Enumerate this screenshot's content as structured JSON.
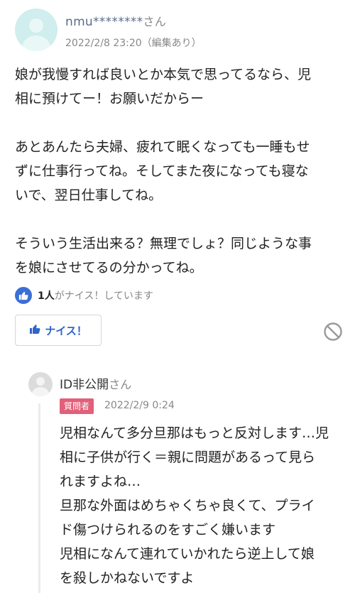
{
  "answer": {
    "user": {
      "name": "nmu********",
      "suffix": "さん"
    },
    "meta": "2022/2/8 23:20（編集あり）",
    "lines": [
      "娘が我慢すれば良いとか本気で思ってるなら、児",
      "相に預けてー！お願いだからー",
      "",
      "あとあんたら夫婦、疲れて眠くなっても一睡もせ",
      "ずに仕事行ってね。そしてまた夜になっても寝な",
      "いで、翌日仕事してね。",
      "",
      "そういう生活出来る？無理でしょ？同じような事",
      "を娘にさせてるの分かってね。"
    ],
    "nice_count": "1人",
    "nice_text": "がナイス！しています",
    "nice_button_label": "ナイス！"
  },
  "reply": {
    "user": {
      "name": "ID非公開",
      "suffix": "さん"
    },
    "badge": "質問者",
    "date": "2022/2/9 0:24",
    "lines": [
      "児相なんて多分旦那はもっと反対します…児",
      "相に子供が行く＝親に問題があるって見ら",
      "れますよね…",
      "旦那な外面はめちゃくちゃ良くて、プライ",
      "ド傷つけられるのをすごく嫌います",
      "児相になんて連れていかれたら逆上して娘",
      "を殺しかねないですよ"
    ]
  },
  "colors": {
    "accent_blue": "#3b6fd8",
    "badge_pink": "#e2607a",
    "username_blue": "#5b6b8a"
  },
  "icons": [
    "avatar",
    "thumbs-up-icon",
    "block-icon"
  ]
}
